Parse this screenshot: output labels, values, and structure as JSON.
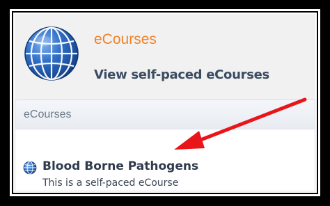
{
  "header": {
    "app_title": "eCourses",
    "app_subtitle": "View self-paced eCourses"
  },
  "panel": {
    "title": "eCourses",
    "items": [
      {
        "title": "Blood Borne Pathogens",
        "description": "This is a self-paced eCourse"
      }
    ]
  },
  "colors": {
    "accent_orange": "#f0832b",
    "annotation_arrow": "#e8161b",
    "globe_blue": "#2a64b4"
  },
  "icons": {
    "header_icon": "globe-icon",
    "item_icon": "globe-icon"
  }
}
